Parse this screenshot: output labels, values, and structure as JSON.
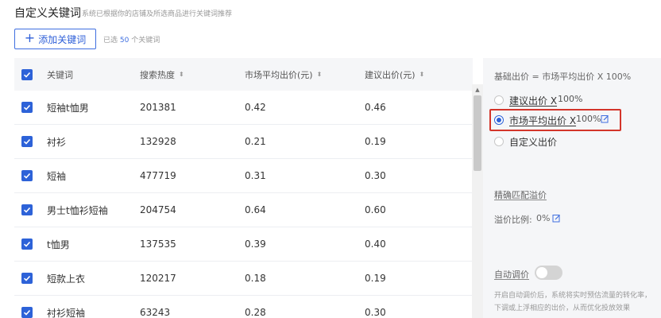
{
  "header": {
    "title": "自定义关键词",
    "subtitle": "系统已根据你的店铺及所选商品进行关键词推荐"
  },
  "toolbar": {
    "add_label": "添加关键词",
    "selected_prefix": "已选",
    "selected_count": "50",
    "selected_suffix": "个关键词"
  },
  "table": {
    "columns": [
      "关键词",
      "搜索热度",
      "市场平均出价(元)",
      "建议出价(元)"
    ],
    "sort_glyph": "⬍",
    "rows": [
      {
        "keyword": "短袖t恤男",
        "heat": "201381",
        "avg_bid": "0.42",
        "suggested_bid": "0.46"
      },
      {
        "keyword": "衬衫",
        "heat": "132928",
        "avg_bid": "0.21",
        "suggested_bid": "0.19"
      },
      {
        "keyword": "短袖",
        "heat": "477719",
        "avg_bid": "0.31",
        "suggested_bid": "0.30"
      },
      {
        "keyword": "男士t恤衫短袖",
        "heat": "204754",
        "avg_bid": "0.64",
        "suggested_bid": "0.60"
      },
      {
        "keyword": "t恤男",
        "heat": "137535",
        "avg_bid": "0.39",
        "suggested_bid": "0.40"
      },
      {
        "keyword": "短款上衣",
        "heat": "120217",
        "avg_bid": "0.18",
        "suggested_bid": "0.19"
      },
      {
        "keyword": "衬衫短袖",
        "heat": "63243",
        "avg_bid": "0.28",
        "suggested_bid": "0.30"
      }
    ]
  },
  "side": {
    "formula": "基础出价 = 市场平均出价 X 100%",
    "options": [
      {
        "label": "建议出价 X",
        "value": "100%",
        "selected": false
      },
      {
        "label": "市场平均出价 X",
        "value": "100%",
        "selected": true
      },
      {
        "label": "自定义出价",
        "value": "",
        "selected": false
      }
    ],
    "exact_match_label": "精确匹配溢价",
    "premium_ratio_label": "溢价比例:",
    "premium_ratio_value": "0%",
    "auto_adjust_label": "自动调价",
    "auto_adjust_on": false,
    "description": "开启自动调价后，系统将实时预估流量的转化率，下调或上浮相应的出价，从而优化投放效果"
  },
  "colors": {
    "accent": "#2d62d8",
    "highlight_border": "#d3352a"
  }
}
